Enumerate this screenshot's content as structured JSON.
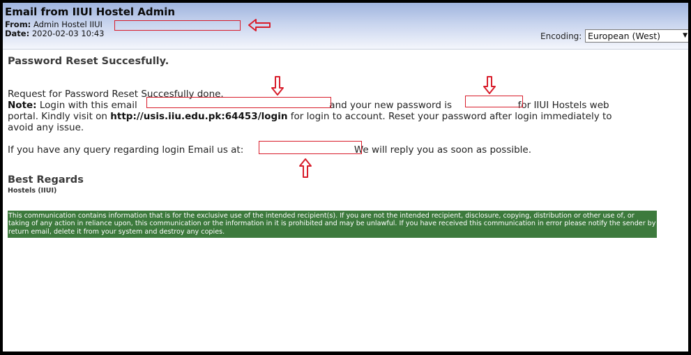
{
  "header": {
    "title": "Email from IIUI Hostel Admin",
    "from_label": "From:",
    "from_value": "Admin Hostel IIUI",
    "date_label": "Date:",
    "date_value": "2020-02-03 10:43"
  },
  "encoding": {
    "label": "Encoding:",
    "selected": "European (West)"
  },
  "email": {
    "heading": "Password Reset Succesfully.",
    "line1": "Request for Password Reset Succesfully done.",
    "note_label": "Note:",
    "note_part1": "Login with this email",
    "note_part2": "and your new password is",
    "note_part3": "for IIUI Hostels web",
    "line3_part1": "portal. Kindly visit on",
    "login_url": "http://usis.iiu.edu.pk:64453/login",
    "line3_part2": "for login to account. Reset your password after login immediately to",
    "line4": "avoid any issue.",
    "query_part1": "If you have any query regarding login Email us at:",
    "query_part2": "We will reply you as soon as possible.",
    "regards": "Best Regards",
    "regards_sub": "Hostels (IIUI)"
  },
  "disclaimer": "This communication contains information that is for the exclusive use of the intended recipient(s). If you are not the intended recipient, disclosure, copying, distribution or other use of, or taking of any action in reliance upon, this communication or the information in it is prohibited and may be unlawful. If you have received this communication in error please notify the sender by return email, delete it from your system and destroy any copies.",
  "colors": {
    "redaction": "#d81c2a",
    "disclaimer_bg": "#3d7a3d"
  },
  "icons": {
    "annotation_arrow": "red-outline-arrow-icon",
    "select_chevron": "chevron-down-icon"
  }
}
